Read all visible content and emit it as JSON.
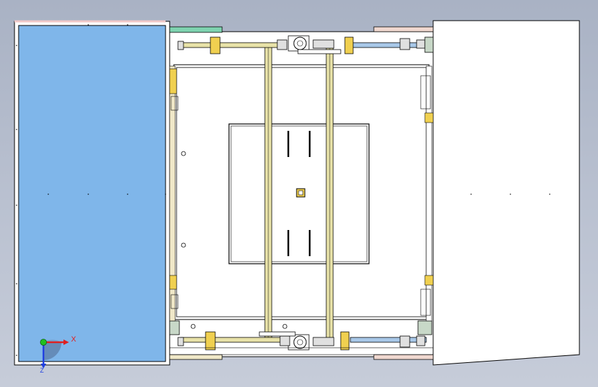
{
  "viewport": {
    "background_top": "#a9b2c4",
    "background_bottom": "#c6ccd9"
  },
  "triad": {
    "x_label": "X",
    "z_label": "Z",
    "x_color": "#e02020",
    "y_color": "#20c020",
    "z_color": "#2040e0"
  },
  "colors": {
    "left_panel_fill": "#7fb6ea",
    "right_panel_fill": "#ffffff",
    "rail_yellow": "#e8e2a8",
    "clamp_yellow": "#f0d050",
    "teal_strip": "#7fd3b0",
    "pink_strip": "#f0d8d0",
    "rod_blue": "#a8c8e8",
    "frame_line": "#000000"
  }
}
